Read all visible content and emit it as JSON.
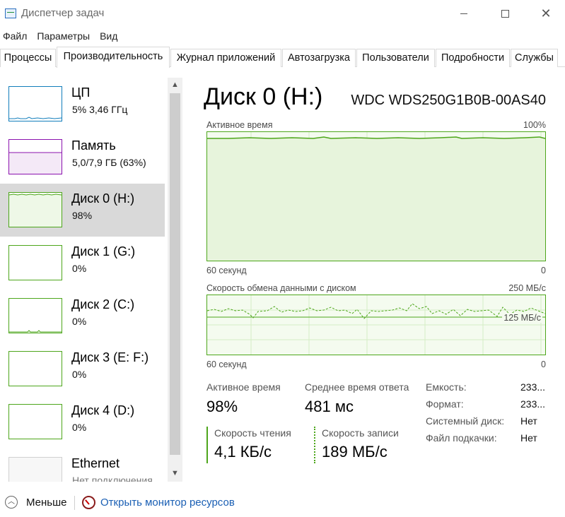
{
  "window": {
    "title": "Диспетчер задач"
  },
  "menu": [
    "Файл",
    "Параметры",
    "Вид"
  ],
  "tabs": [
    "Процессы",
    "Производительность",
    "Журнал приложений",
    "Автозагрузка",
    "Пользователи",
    "Подробности",
    "Службы"
  ],
  "active_tab": "Производительность",
  "sidebar": {
    "items": [
      {
        "title": "ЦП",
        "sub": "5% 3,46 ГГц",
        "color": "#117dbb",
        "selected": false
      },
      {
        "title": "Память",
        "sub": "5,0/7,9 ГБ (63%)",
        "color": "#8b12ae",
        "selected": false
      },
      {
        "title": "Диск 0 (H:)",
        "sub": "98%",
        "color": "#4da61b",
        "selected": true
      },
      {
        "title": "Диск 1 (G:)",
        "sub": "0%",
        "color": "#4da61b",
        "selected": false
      },
      {
        "title": "Диск 2 (C:)",
        "sub": "0%",
        "color": "#4da61b",
        "selected": false
      },
      {
        "title": "Диск 3 (E: F:)",
        "sub": "0%",
        "color": "#4da61b",
        "selected": false
      },
      {
        "title": "Диск 4 (D:)",
        "sub": "0%",
        "color": "#4da61b",
        "selected": false
      },
      {
        "title": "Ethernet",
        "sub": "Нет подключения",
        "color": "#a7a7a7",
        "selected": false
      }
    ]
  },
  "detail": {
    "title": "Диск 0 (H:)",
    "model": "WDC WDS250G1B0B-00AS40",
    "chart1": {
      "label": "Активное время",
      "max": "100%",
      "time": "60 секунд",
      "min": "0"
    },
    "chart2": {
      "label": "Скорость обмена данными с диском",
      "max": "250 МБ/с",
      "mid": "125 МБ/с",
      "time": "60 секунд",
      "min": "0"
    },
    "stats": {
      "active_label": "Активное время",
      "active_value": "98%",
      "response_label": "Среднее время ответа",
      "response_value": "481 мс",
      "read_label": "Скорость чтения",
      "read_value": "4,1 КБ/с",
      "write_label": "Скорость записи",
      "write_value": "189 МБ/с"
    },
    "props": [
      {
        "label": "Емкость:",
        "value": "233..."
      },
      {
        "label": "Формат:",
        "value": "233..."
      },
      {
        "label": "Системный диск:",
        "value": "Нет"
      },
      {
        "label": "Файл подкачки:",
        "value": "Нет"
      }
    ]
  },
  "bottom": {
    "fewer": "Меньше",
    "monitor": "Открыть монитор ресурсов"
  },
  "colors": {
    "disk": "#4da61b",
    "cpu": "#117dbb",
    "memory": "#8b12ae",
    "link": "#1a5fb4"
  }
}
